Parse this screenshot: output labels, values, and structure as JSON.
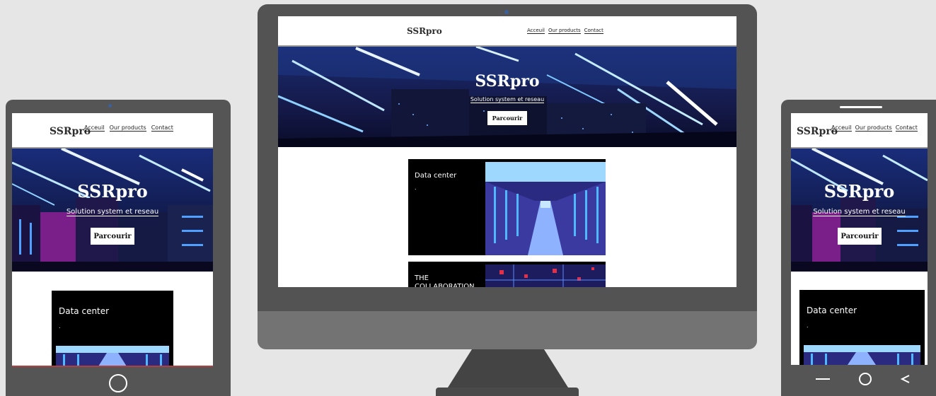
{
  "site": {
    "logo": "SSRpro",
    "nav": {
      "home": "Acceuil",
      "products": "Our products",
      "contact": "Contact"
    },
    "hero": {
      "title": "SSRpro",
      "subtitle": "Solution system et reseau",
      "cta": "Parcourir"
    },
    "cards": [
      {
        "title": "Data center",
        "text": "."
      },
      {
        "title": "THE COLLABORATION"
      }
    ]
  },
  "icons": {
    "tablet_home": "home-circle-icon",
    "phone_nav": [
      "recent-apps-dash-icon",
      "home-circle-icon",
      "back-chevron-icon"
    ]
  },
  "colors": {
    "background": "#e6e6e6",
    "device_frame": "#555555",
    "card": "#000000"
  }
}
